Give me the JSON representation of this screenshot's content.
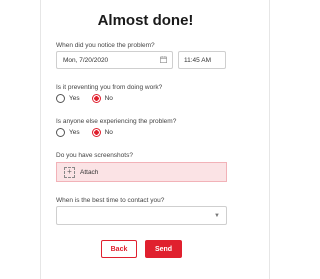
{
  "title": "Almost done!",
  "questions": {
    "notice": {
      "label": "When did you notice the problem?",
      "date_value": "Mon, 7/20/2020",
      "time_value": "11:45 AM"
    },
    "preventing": {
      "label": "Is it preventing you from doing work?",
      "options": [
        "Yes",
        "No"
      ],
      "selected": "No"
    },
    "others": {
      "label": "Is anyone else experiencing the problem?",
      "options": [
        "Yes",
        "No"
      ],
      "selected": "No"
    },
    "screenshots": {
      "label": "Do you have screenshots?",
      "attach_label": "Attach"
    },
    "contact_time": {
      "label": "When is the best time to contact you?",
      "value": ""
    }
  },
  "buttons": {
    "back": "Back",
    "send": "Send"
  },
  "colors": {
    "accent": "#e0202e",
    "attach_bg": "#fbe3e5"
  }
}
